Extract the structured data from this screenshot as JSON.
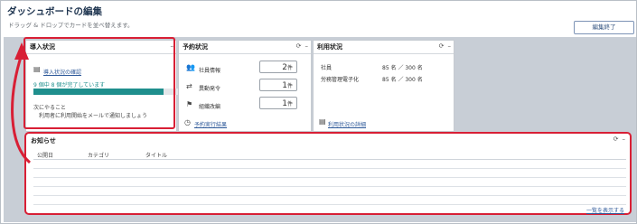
{
  "header": {
    "title": "ダッシュボードの編集",
    "subtitle": "ドラッグ & ドロップでカードを並べ替えます。",
    "done_button": "編集終了"
  },
  "intro_panel": {
    "title": "導入状況",
    "menu_icon": "–",
    "check_link": "導入状況の確認",
    "progress_text": "9 個中 8 個が完了しています",
    "progress_fraction": 0.89,
    "next_heading": "次にやること",
    "next_item": "利用者に利用開始をメールで通知しましょう"
  },
  "reservation_panel": {
    "title": "予約状況",
    "rows": [
      {
        "icon": "users-icon",
        "label": "社員情報",
        "count": "2",
        "unit": "件"
      },
      {
        "icon": "transfer-icon",
        "label": "異動発令",
        "count": "1",
        "unit": "件"
      },
      {
        "icon": "org-chart-icon",
        "label": "組織改編",
        "count": "1",
        "unit": "件"
      }
    ],
    "history_link": "予約実行結果"
  },
  "usage_panel": {
    "title": "利用状況",
    "rows": [
      {
        "label": "社員",
        "value": "85 名 ／ 300 名"
      },
      {
        "label": "労務管理電子化",
        "value": "85 名 ／ 300 名"
      }
    ],
    "detail_link": "利用状況の詳細"
  },
  "notice_panel": {
    "title": "お知らせ",
    "columns": [
      "公開日",
      "カテゴリ",
      "タイトル"
    ],
    "more_link": "一覧を表示する"
  },
  "colors": {
    "accent_red": "#d81f35",
    "progress": "#1f8f8d",
    "link": "#2f5a9a"
  }
}
